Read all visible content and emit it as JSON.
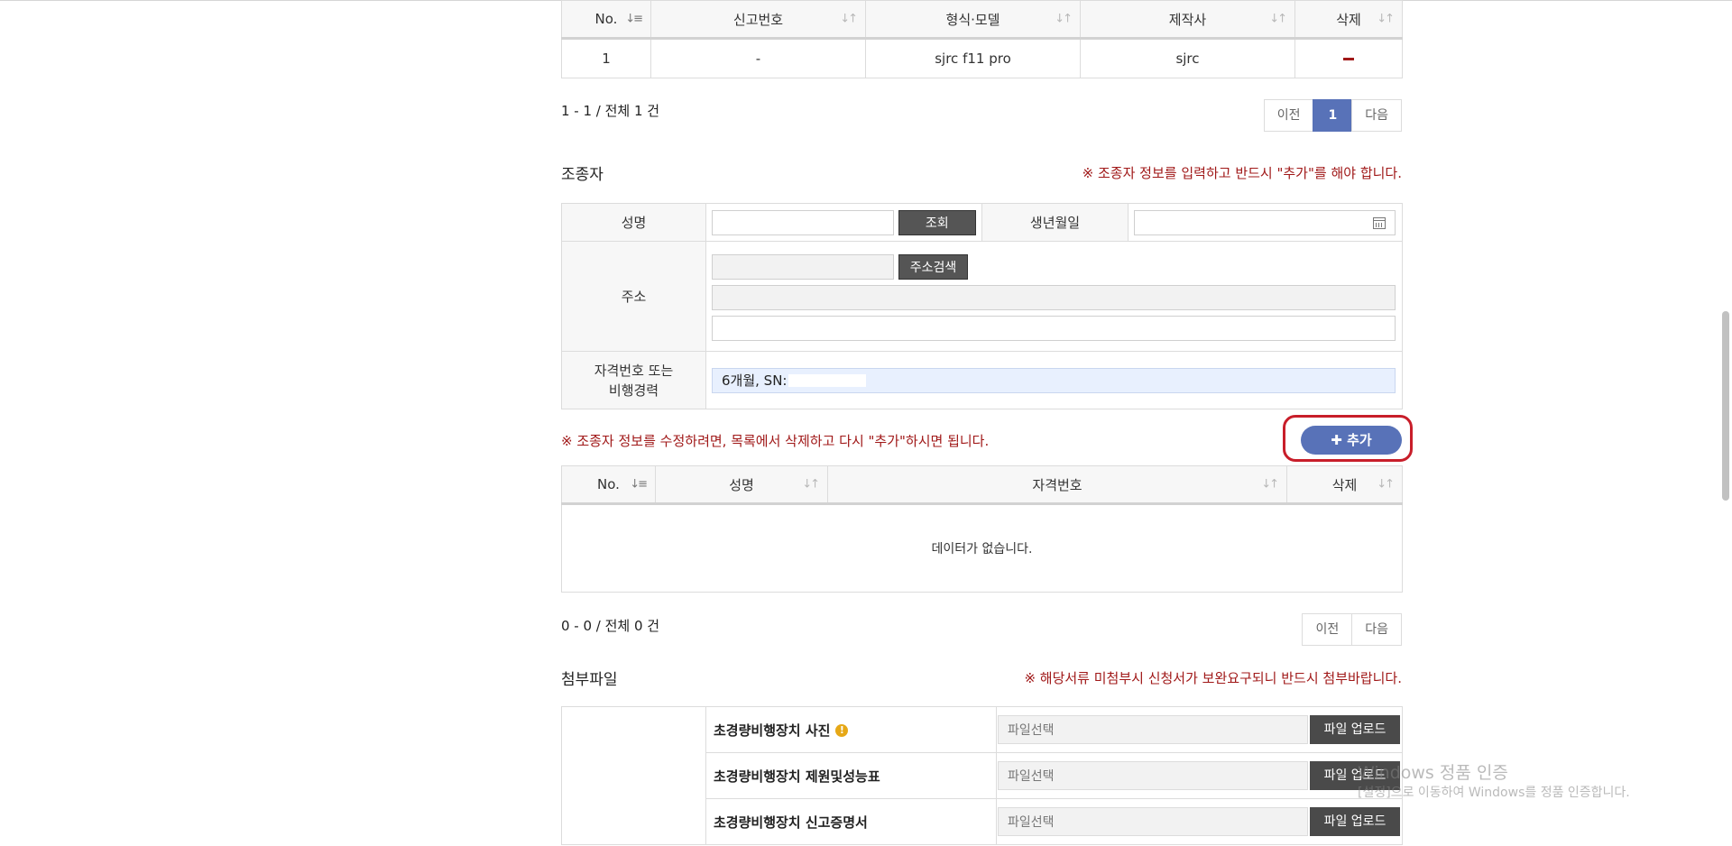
{
  "drone_table": {
    "headers": [
      "No.",
      "신고번호",
      "형식·모델",
      "제작사",
      "삭제"
    ],
    "rows": [
      {
        "no": "1",
        "report_no": "-",
        "model": "sjrc f11 pro",
        "maker": "sjrc"
      }
    ],
    "count_text": "1 - 1 / 전체 1 건",
    "pager": {
      "prev": "이전",
      "page": "1",
      "next": "다음"
    }
  },
  "pilot": {
    "title": "조종자",
    "notice": "※ 조종자 정보를 입력하고 반드시 \"추가\"를 해야 합니다.",
    "name_label": "성명",
    "lookup_button": "조회",
    "birth_label": "생년월일",
    "address_label": "주소",
    "address_search_button": "주소검색",
    "license_label_line1": "자격번호 또는",
    "license_label_line2": "비행경력",
    "license_value": "6개월, SN:",
    "edit_notice": "※ 조종자 정보를 수정하려면, 목록에서 삭제하고 다시 \"추가\"하시면 됩니다.",
    "add_button": "추가"
  },
  "pilot_table": {
    "headers": [
      "No.",
      "성명",
      "자격번호",
      "삭제"
    ],
    "empty_text": "데이터가 없습니다.",
    "count_text": "0 - 0 / 전체 0 건",
    "pager": {
      "prev": "이전",
      "next": "다음"
    }
  },
  "attachments": {
    "title": "첨부파일",
    "notice": "※ 해당서류 미첨부시 신청서가 보완요구되니 반드시 첨부바랍니다.",
    "placeholder": "파일선택",
    "upload_button": "파일 업로드",
    "items": [
      {
        "name": "초경량비행장치 사진"
      },
      {
        "name": "초경량비행장치 제원및성능표"
      },
      {
        "name": "초경량비행장치 신고증명서"
      }
    ]
  },
  "watermark": {
    "line1": "Windows 정품 인증",
    "line2": "[설정]으로 이동하여 Windows를 정품 인증합니다."
  },
  "colors": {
    "accent": "#5872b8",
    "notice_red": "#a01818",
    "highlight_ring": "#c81e2a"
  }
}
